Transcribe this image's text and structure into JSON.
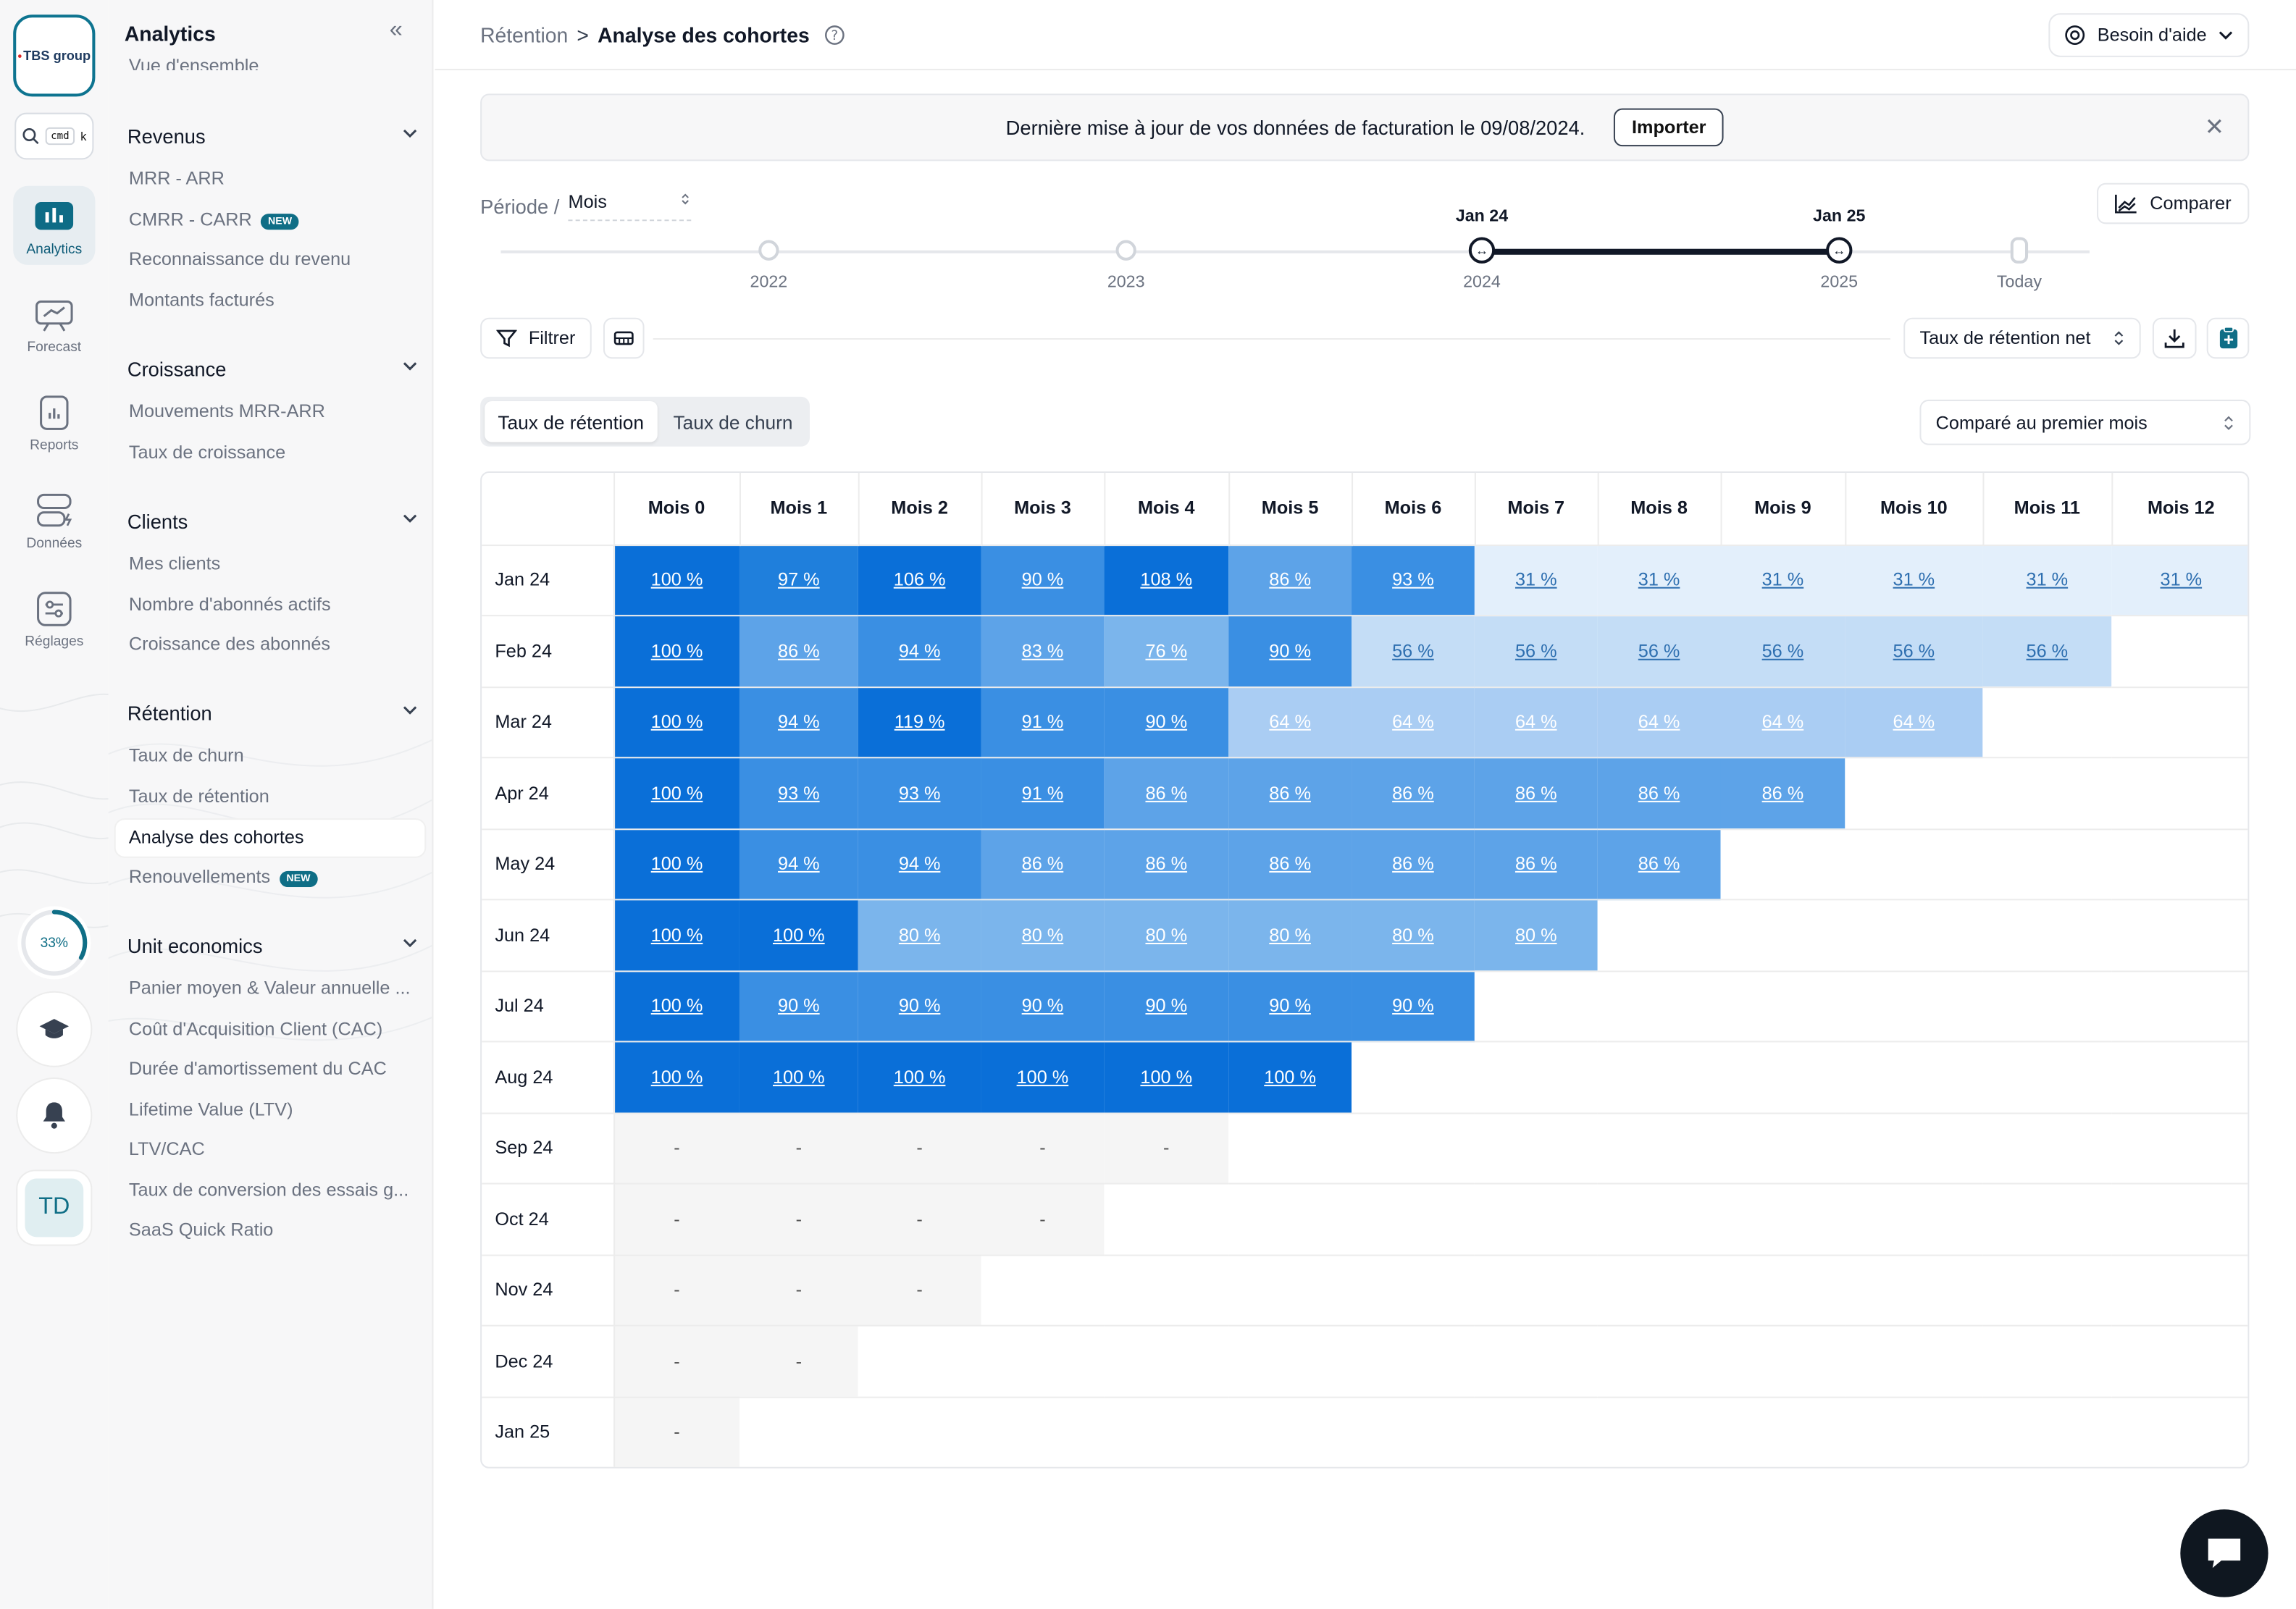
{
  "logo": {
    "text": "TBS group",
    "star": "•"
  },
  "search": {
    "cmd_key": "cmd",
    "k_key": "k"
  },
  "rail": {
    "items": [
      {
        "label": "Analytics",
        "icon": "bar-chart-icon"
      },
      {
        "label": "Forecast",
        "icon": "presentation-chart-icon"
      },
      {
        "label": "Reports",
        "icon": "report-icon"
      },
      {
        "label": "Données",
        "icon": "database-icon"
      },
      {
        "label": "Réglages",
        "icon": "sliders-icon"
      }
    ],
    "progress": "33%",
    "progress_value": 0.33,
    "avatar": "TD"
  },
  "sidenav": {
    "title": "Analytics",
    "cut_item": "Vue d'ensemble",
    "sections": [
      {
        "label": "Revenus",
        "items": [
          {
            "label": "MRR - ARR"
          },
          {
            "label": "CMRR - CARR",
            "badge": "NEW"
          },
          {
            "label": "Reconnaissance du revenu"
          },
          {
            "label": "Montants facturés"
          }
        ]
      },
      {
        "label": "Croissance",
        "items": [
          {
            "label": "Mouvements MRR-ARR"
          },
          {
            "label": "Taux de croissance"
          }
        ]
      },
      {
        "label": "Clients",
        "items": [
          {
            "label": "Mes clients"
          },
          {
            "label": "Nombre d'abonnés actifs"
          },
          {
            "label": "Croissance des abonnés"
          }
        ]
      },
      {
        "label": "Rétention",
        "items": [
          {
            "label": "Taux de churn"
          },
          {
            "label": "Taux de rétention"
          },
          {
            "label": "Analyse des cohortes"
          },
          {
            "label": "Renouvellements",
            "badge": "NEW"
          }
        ]
      },
      {
        "label": "Unit economics",
        "items": [
          {
            "label": "Panier moyen & Valeur annuelle ..."
          },
          {
            "label": "Coût d'Acquisition Client (CAC)"
          },
          {
            "label": "Durée d'amortissement du CAC"
          },
          {
            "label": "Lifetime Value (LTV)"
          },
          {
            "label": "LTV/CAC"
          },
          {
            "label": "Taux de conversion des essais g..."
          },
          {
            "label": "SaaS Quick Ratio"
          }
        ]
      }
    ]
  },
  "breadcrumb": {
    "parent": "Rétention",
    "separator": ">",
    "current": "Analyse des cohortes"
  },
  "help_label": "Besoin d'aide",
  "banner": {
    "text": "Dernière mise à jour de vos données de facturation le 09/08/2024.",
    "button": "Importer"
  },
  "period": {
    "label": "Période /",
    "value": "Mois"
  },
  "compare_label": "Comparer",
  "timeline": {
    "years": [
      "2022",
      "2023",
      "2024",
      "2025",
      "Today"
    ],
    "start": "Jan 24",
    "end": "Jan 25"
  },
  "toolbar": {
    "filter": "Filtrer",
    "metric": "Taux de rétention net"
  },
  "tabs": [
    "Taux de rétention",
    "Taux de churn"
  ],
  "compare_select": "Comparé au premier mois",
  "colors": {
    "blue_dark": "#0a6fd8",
    "blue_mid": "#3a8fe3",
    "blue_light": "#aacdf3",
    "blue_pale": "#e3effb",
    "accent": "#0f6e86"
  },
  "cohort": {
    "columns": [
      "Mois 0",
      "Mois 1",
      "Mois 2",
      "Mois 3",
      "Mois 4",
      "Mois 5",
      "Mois 6",
      "Mois 7",
      "Mois 8",
      "Mois 9",
      "Mois 10",
      "Mois 11",
      "Mois 12"
    ],
    "rows": [
      {
        "label": "Jan 24",
        "values": [
          "100 %",
          "97 %",
          "106 %",
          "90 %",
          "108 %",
          "86 %",
          "93 %",
          "31 %",
          "31 %",
          "31 %",
          "31 %",
          "31 %",
          "31 %"
        ]
      },
      {
        "label": "Feb 24",
        "values": [
          "100 %",
          "86 %",
          "94 %",
          "83 %",
          "76 %",
          "90 %",
          "56 %",
          "56 %",
          "56 %",
          "56 %",
          "56 %",
          "56 %"
        ]
      },
      {
        "label": "Mar 24",
        "values": [
          "100 %",
          "94 %",
          "119 %",
          "91 %",
          "90 %",
          "64 %",
          "64 %",
          "64 %",
          "64 %",
          "64 %",
          "64 %"
        ]
      },
      {
        "label": "Apr 24",
        "values": [
          "100 %",
          "93 %",
          "93 %",
          "91 %",
          "86 %",
          "86 %",
          "86 %",
          "86 %",
          "86 %",
          "86 %"
        ]
      },
      {
        "label": "May 24",
        "values": [
          "100 %",
          "94 %",
          "94 %",
          "86 %",
          "86 %",
          "86 %",
          "86 %",
          "86 %",
          "86 %"
        ]
      },
      {
        "label": "Jun 24",
        "values": [
          "100 %",
          "100 %",
          "80 %",
          "80 %",
          "80 %",
          "80 %",
          "80 %",
          "80 %"
        ]
      },
      {
        "label": "Jul 24",
        "values": [
          "100 %",
          "90 %",
          "90 %",
          "90 %",
          "90 %",
          "90 %",
          "90 %"
        ]
      },
      {
        "label": "Aug 24",
        "values": [
          "100 %",
          "100 %",
          "100 %",
          "100 %",
          "100 %",
          "100 %"
        ]
      },
      {
        "label": "Sep 24",
        "values": [
          "-",
          "-",
          "-",
          "-",
          "-"
        ]
      },
      {
        "label": "Oct 24",
        "values": [
          "-",
          "-",
          "-",
          "-"
        ]
      },
      {
        "label": "Nov 24",
        "values": [
          "-",
          "-",
          "-"
        ]
      },
      {
        "label": "Dec 24",
        "values": [
          "-",
          "-"
        ]
      },
      {
        "label": "Jan 25",
        "values": [
          "-"
        ]
      }
    ]
  }
}
